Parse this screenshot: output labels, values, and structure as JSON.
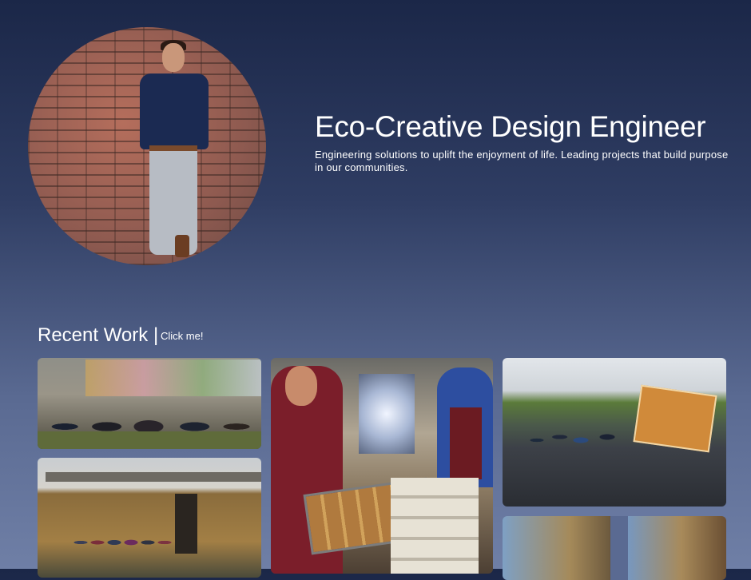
{
  "hero": {
    "title": "Eco-Creative Design Engineer",
    "subtitle": "Engineering solutions to uplift the enjoyment of life. Leading projects that build purpose in our communities."
  },
  "recent": {
    "title": "Recent Work |",
    "link_label": "Click me!"
  },
  "colors": {
    "background_top": "#1b2748",
    "background_bottom": "#6f7fa6",
    "text": "#ffffff"
  }
}
